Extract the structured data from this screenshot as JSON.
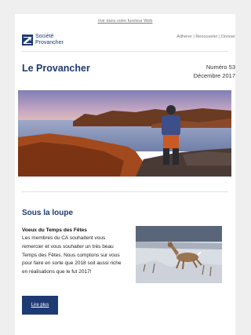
{
  "header": {
    "webview_link": "Voir dans votre fureteur Web",
    "logo_line1": "Société",
    "logo_line2": "Provancher",
    "top_links": "Adhérer | Renouveler | Donner"
  },
  "masthead": {
    "title": "Le Provancher",
    "issue_number": "Numéro 53",
    "issue_date": "Décembre 2017"
  },
  "section": {
    "title": "Sous la loupe",
    "article_title": "Voeux du Temps des Fêtes",
    "article_body": "Les membres du CA souhaitent vous remercier et vous souhaiter un très beau Temps des Fêtes. Nous comptons sur vous pour faire en sorte que 2018 soit aussi riche en réalisations que le fut 2017!",
    "read_more": "Lire plus"
  },
  "colors": {
    "brand_blue": "#1e3a73",
    "page_bg": "#efefef"
  },
  "icons": {
    "logo": "provancher-logo-icon"
  }
}
